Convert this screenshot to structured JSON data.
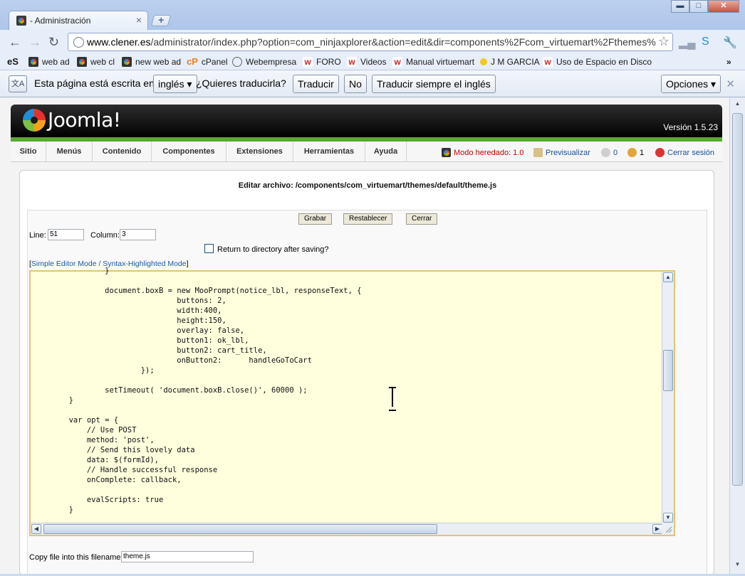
{
  "browser": {
    "tab_title": "- Administración",
    "tab_close": "×",
    "new_tab": "+",
    "window_controls": {
      "minimize": "▬",
      "maximize": "□",
      "close": "✕"
    },
    "url_host": "www.clener.es",
    "url_path": "/administrator/index.php?option=com_ninjaxplorer&action=edit&dir=components%2Fcom_virtuemart%2Fthemes%",
    "nav": {
      "back": "←",
      "forward": "→",
      "reload": "↻"
    },
    "bookmarks": [
      {
        "label": "",
        "icon": "es-icon"
      },
      {
        "label": "web ad",
        "icon": "joomla-icon"
      },
      {
        "label": "web cl",
        "icon": "joomla-icon"
      },
      {
        "label": "new web ad",
        "icon": "joomla-icon"
      },
      {
        "label": "cPanel",
        "icon": "cpanel-icon"
      },
      {
        "label": "Webempresa",
        "icon": "globe-icon"
      },
      {
        "label": "FORO",
        "icon": "w-icon"
      },
      {
        "label": "Videos",
        "icon": "w-icon"
      },
      {
        "label": "Manual virtuemart",
        "icon": "w-icon"
      },
      {
        "label": "J M GARCIA",
        "icon": "dot-icon"
      },
      {
        "label": "Uso de Espacio en Disco",
        "icon": "w-icon"
      }
    ],
    "bookmarks_more": "»"
  },
  "translate_bar": {
    "text_prefix": "Esta página está escrita en",
    "language": "inglés ▾",
    "question": "¿Quieres traducirla?",
    "translate_button": "Traducir",
    "no_button": "No",
    "always_button": "Traducir siempre el inglés",
    "options_button": "Opciones ▾",
    "close": "✕"
  },
  "joomla": {
    "logo_text": "Joomla!",
    "version": "Versión 1.5.23",
    "menu": [
      "Sitio",
      "Menús",
      "Contenido",
      "Componentes",
      "Extensiones",
      "Herramientas",
      "Ayuda"
    ],
    "status": {
      "legacy_mode": "Modo heredado: 1.0",
      "preview": "Previsualizar",
      "messages_count": "0",
      "users_count": "1",
      "logout": "Cerrar sesión"
    },
    "page_title": "Editar archivo: /components/com_virtuemart/themes/default/theme.js",
    "buttons": {
      "save": "Grabar",
      "reset": "Restablecer",
      "close": "Cerrar"
    },
    "line_label": "Line:",
    "line_value": "51",
    "column_label": "Column:",
    "column_value": "3",
    "return_label": "Return to directory after saving?",
    "mode_link": "Simple Editor Mode / Syntax-Highlighted Mode",
    "mode_link_open": "[",
    "mode_link_close": "]",
    "copy_label": "Copy file into this filename",
    "copy_value": "theme.js"
  },
  "editor": {
    "lines": [
      "                }",
      "",
      "                document.boxB = new MooPrompt(notice_lbl, responseText, {",
      "                                buttons: 2,",
      "                                width:400,",
      "                                height:150,",
      "                                overlay: false,",
      "                                button1: ok_lbl,",
      "                                button2: cart_title,",
      "                                onButton2:      handleGoToCart",
      "                        });",
      "",
      "                setTimeout( 'document.boxB.close()', 60000 );",
      "        }",
      "",
      "        var opt = {",
      "            // Use POST",
      "            method: 'post',",
      "            // Send this lovely data",
      "            data: $(formId),",
      "            // Handle successful response",
      "            onComplete: callback,",
      "",
      "            evalScripts: true",
      "        }"
    ]
  }
}
